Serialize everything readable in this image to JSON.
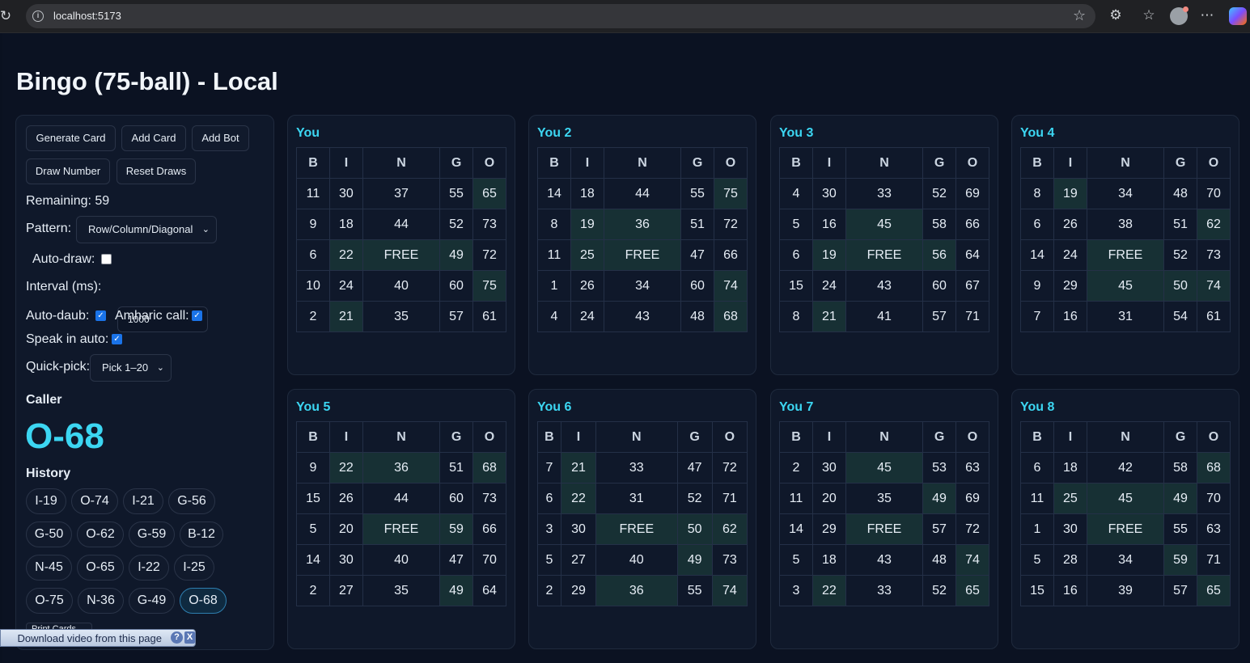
{
  "browser": {
    "url": "localhost:5173"
  },
  "title": "Bingo (75-ball) - Local",
  "controls": {
    "buttons": [
      "Generate Card",
      "Add Card",
      "Add Bot",
      "Draw Number",
      "Reset Draws"
    ],
    "remaining": "Remaining: 59",
    "pattern_label": "Pattern:",
    "pattern_value": "Row/Column/Diagonal",
    "autodraw_label": "Auto-draw:",
    "autodraw_checked": false,
    "interval_label": "Interval (ms):",
    "interval_value": "1000",
    "autodaub_label": "Auto-daub:",
    "autodaub_checked": true,
    "amharic_label": "Amharic call:",
    "amharic_checked": true,
    "speak_label": "Speak in auto:",
    "speak_checked": true,
    "quickpick_label": "Quick-pick:",
    "quickpick_value": "Pick 1–20",
    "print_label": "Print Cards"
  },
  "caller": {
    "title": "Caller",
    "current": "O-68",
    "history_title": "History",
    "history": [
      "I-19",
      "O-74",
      "I-21",
      "G-56",
      "G-50",
      "O-62",
      "G-59",
      "B-12",
      "N-45",
      "O-65",
      "I-22",
      "I-25",
      "O-75",
      "N-36",
      "G-49",
      "O-68"
    ]
  },
  "overlay": {
    "download_text": "Download video from this page",
    "help": "?",
    "close": "X"
  },
  "card_headers": [
    "B",
    "I",
    "N",
    "G",
    "O"
  ],
  "cards": [
    {
      "name": "You",
      "rows": [
        [
          "11",
          "30",
          "37",
          "55",
          "65"
        ],
        [
          "9",
          "18",
          "44",
          "52",
          "73"
        ],
        [
          "6",
          "22",
          "FREE",
          "49",
          "72"
        ],
        [
          "10",
          "24",
          "40",
          "60",
          "75"
        ],
        [
          "2",
          "21",
          "35",
          "57",
          "61"
        ]
      ],
      "marked": [
        [
          0,
          4
        ],
        [
          2,
          1
        ],
        [
          2,
          2
        ],
        [
          2,
          3
        ],
        [
          3,
          4
        ],
        [
          4,
          1
        ]
      ]
    },
    {
      "name": "You 2",
      "rows": [
        [
          "14",
          "18",
          "44",
          "55",
          "75"
        ],
        [
          "8",
          "19",
          "36",
          "51",
          "72"
        ],
        [
          "11",
          "25",
          "FREE",
          "47",
          "66"
        ],
        [
          "1",
          "26",
          "34",
          "60",
          "74"
        ],
        [
          "4",
          "24",
          "43",
          "48",
          "68"
        ]
      ],
      "marked": [
        [
          0,
          4
        ],
        [
          1,
          1
        ],
        [
          1,
          2
        ],
        [
          2,
          1
        ],
        [
          2,
          2
        ],
        [
          3,
          4
        ],
        [
          4,
          4
        ]
      ]
    },
    {
      "name": "You 3",
      "rows": [
        [
          "4",
          "30",
          "33",
          "52",
          "69"
        ],
        [
          "5",
          "16",
          "45",
          "58",
          "66"
        ],
        [
          "6",
          "19",
          "FREE",
          "56",
          "64"
        ],
        [
          "15",
          "24",
          "43",
          "60",
          "67"
        ],
        [
          "8",
          "21",
          "41",
          "57",
          "71"
        ]
      ],
      "marked": [
        [
          1,
          2
        ],
        [
          2,
          1
        ],
        [
          2,
          2
        ],
        [
          2,
          3
        ],
        [
          4,
          1
        ]
      ]
    },
    {
      "name": "You 4",
      "rows": [
        [
          "8",
          "19",
          "34",
          "48",
          "70"
        ],
        [
          "6",
          "26",
          "38",
          "51",
          "62"
        ],
        [
          "14",
          "24",
          "FREE",
          "52",
          "73"
        ],
        [
          "9",
          "29",
          "45",
          "50",
          "74"
        ],
        [
          "7",
          "16",
          "31",
          "54",
          "61"
        ]
      ],
      "marked": [
        [
          0,
          1
        ],
        [
          1,
          4
        ],
        [
          2,
          2
        ],
        [
          3,
          2
        ],
        [
          3,
          3
        ],
        [
          3,
          4
        ]
      ]
    },
    {
      "name": "You 5",
      "rows": [
        [
          "9",
          "22",
          "36",
          "51",
          "68"
        ],
        [
          "15",
          "26",
          "44",
          "60",
          "73"
        ],
        [
          "5",
          "20",
          "FREE",
          "59",
          "66"
        ],
        [
          "14",
          "30",
          "40",
          "47",
          "70"
        ],
        [
          "2",
          "27",
          "35",
          "49",
          "64"
        ]
      ],
      "marked": [
        [
          0,
          1
        ],
        [
          0,
          2
        ],
        [
          0,
          4
        ],
        [
          2,
          2
        ],
        [
          2,
          3
        ],
        [
          4,
          3
        ]
      ]
    },
    {
      "name": "You 6",
      "rows": [
        [
          "7",
          "21",
          "33",
          "47",
          "72"
        ],
        [
          "6",
          "22",
          "31",
          "52",
          "71"
        ],
        [
          "3",
          "30",
          "FREE",
          "50",
          "62"
        ],
        [
          "5",
          "27",
          "40",
          "49",
          "73"
        ],
        [
          "2",
          "29",
          "36",
          "55",
          "74"
        ]
      ],
      "marked": [
        [
          0,
          1
        ],
        [
          1,
          1
        ],
        [
          2,
          2
        ],
        [
          2,
          3
        ],
        [
          2,
          4
        ],
        [
          3,
          3
        ],
        [
          4,
          2
        ],
        [
          4,
          4
        ]
      ]
    },
    {
      "name": "You 7",
      "rows": [
        [
          "2",
          "30",
          "45",
          "53",
          "63"
        ],
        [
          "11",
          "20",
          "35",
          "49",
          "69"
        ],
        [
          "14",
          "29",
          "FREE",
          "57",
          "72"
        ],
        [
          "5",
          "18",
          "43",
          "48",
          "74"
        ],
        [
          "3",
          "22",
          "33",
          "52",
          "65"
        ]
      ],
      "marked": [
        [
          0,
          2
        ],
        [
          1,
          3
        ],
        [
          2,
          2
        ],
        [
          3,
          4
        ],
        [
          4,
          1
        ],
        [
          4,
          4
        ]
      ]
    },
    {
      "name": "You 8",
      "rows": [
        [
          "6",
          "18",
          "42",
          "58",
          "68"
        ],
        [
          "11",
          "25",
          "45",
          "49",
          "70"
        ],
        [
          "1",
          "30",
          "FREE",
          "55",
          "63"
        ],
        [
          "5",
          "28",
          "34",
          "59",
          "71"
        ],
        [
          "15",
          "16",
          "39",
          "57",
          "65"
        ]
      ],
      "marked": [
        [
          0,
          4
        ],
        [
          1,
          1
        ],
        [
          1,
          2
        ],
        [
          1,
          3
        ],
        [
          2,
          2
        ],
        [
          3,
          3
        ],
        [
          4,
          4
        ]
      ]
    }
  ]
}
